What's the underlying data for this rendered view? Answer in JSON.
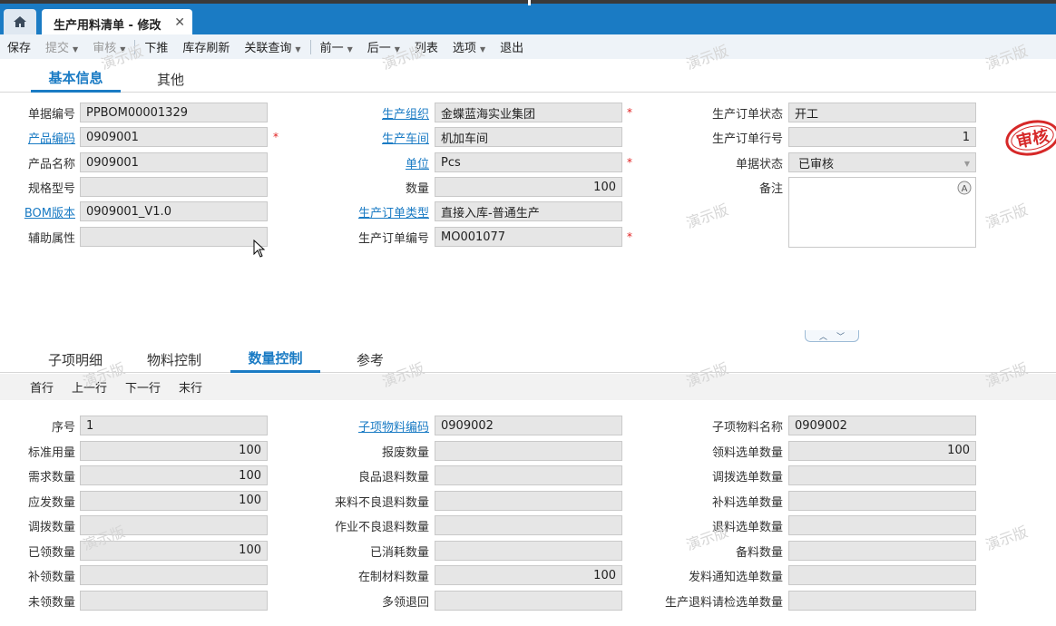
{
  "tabs": {
    "document_tab": "生产用料清单 - 修改"
  },
  "toolbar": [
    {
      "label": "保存",
      "disabled": false,
      "dropdown": false
    },
    {
      "label": "提交",
      "disabled": true,
      "dropdown": true
    },
    {
      "label": "审核",
      "disabled": true,
      "dropdown": true
    },
    {
      "sep": true
    },
    {
      "label": "下推",
      "disabled": false,
      "dropdown": false
    },
    {
      "label": "库存刷新",
      "disabled": false,
      "dropdown": false
    },
    {
      "label": "关联查询",
      "disabled": false,
      "dropdown": true
    },
    {
      "sep": true
    },
    {
      "label": "前一",
      "disabled": false,
      "dropdown": true
    },
    {
      "label": "后一",
      "disabled": false,
      "dropdown": true
    },
    {
      "label": "列表",
      "disabled": false,
      "dropdown": false
    },
    {
      "label": "选项",
      "disabled": false,
      "dropdown": true
    },
    {
      "label": "退出",
      "disabled": false,
      "dropdown": false
    }
  ],
  "watermark": "演示版",
  "header_tabs": [
    "基本信息",
    "其他"
  ],
  "header": {
    "bill_no": {
      "label": "单据编号",
      "value": "PPBOM00001329"
    },
    "material_code": {
      "label": "产品编码",
      "value": "0909001"
    },
    "material_name": {
      "label": "产品名称",
      "value": "0909001"
    },
    "spec": {
      "label": "规格型号",
      "value": ""
    },
    "bom_version": {
      "label": "BOM版本",
      "value": "0909001_V1.0"
    },
    "aux_prop": {
      "label": "辅助属性",
      "value": ""
    },
    "prd_org": {
      "label": "生产组织",
      "value": "金蝶蓝海实业集团"
    },
    "workshop": {
      "label": "生产车间",
      "value": "机加车间"
    },
    "unit": {
      "label": "单位",
      "value": "Pcs"
    },
    "qty": {
      "label": "数量",
      "value": "100"
    },
    "mo_type": {
      "label": "生产订单类型",
      "value": "直接入库-普通生产"
    },
    "mo_no": {
      "label": "生产订单编号",
      "value": "MO001077"
    },
    "mo_status": {
      "label": "生产订单状态",
      "value": "开工"
    },
    "mo_line": {
      "label": "生产订单行号",
      "value": "1"
    },
    "doc_status": {
      "label": "单据状态",
      "value": "已审核"
    },
    "remark": {
      "label": "备注",
      "value": ""
    }
  },
  "stamp": "审核",
  "entry_tabs": [
    "子项明细",
    "物料控制",
    "数量控制",
    "参考"
  ],
  "entry_nav": [
    "首行",
    "上一行",
    "下一行",
    "末行"
  ],
  "qty_control": {
    "col1": [
      {
        "label": "序号",
        "value": "1",
        "num": false
      },
      {
        "label": "标准用量",
        "value": "100",
        "num": true
      },
      {
        "label": "需求数量",
        "value": "100",
        "num": true
      },
      {
        "label": "应发数量",
        "value": "100",
        "num": true
      },
      {
        "label": "调拨数量",
        "value": "",
        "num": true
      },
      {
        "label": "已领数量",
        "value": "100",
        "num": true
      },
      {
        "label": "补领数量",
        "value": "",
        "num": true
      },
      {
        "label": "未领数量",
        "value": "",
        "num": true
      }
    ],
    "col2": [
      {
        "label": "子项物料编码",
        "value": "0909002",
        "num": false,
        "link": true
      },
      {
        "label": "报废数量",
        "value": "",
        "num": true
      },
      {
        "label": "良品退料数量",
        "value": "",
        "num": true
      },
      {
        "label": "来料不良退料数量",
        "value": "",
        "num": true
      },
      {
        "label": "作业不良退料数量",
        "value": "",
        "num": true
      },
      {
        "label": "已消耗数量",
        "value": "",
        "num": true
      },
      {
        "label": "在制材料数量",
        "value": "100",
        "num": true
      },
      {
        "label": "多领退回",
        "value": "",
        "num": true
      }
    ],
    "col3": [
      {
        "label": "子项物料名称",
        "value": "0909002",
        "num": false
      },
      {
        "label": "领料选单数量",
        "value": "100",
        "num": true
      },
      {
        "label": "调拨选单数量",
        "value": "",
        "num": true
      },
      {
        "label": "补料选单数量",
        "value": "",
        "num": true
      },
      {
        "label": "退料选单数量",
        "value": "",
        "num": true
      },
      {
        "label": "备料数量",
        "value": "",
        "num": true
      },
      {
        "label": "发料通知选单数量",
        "value": "",
        "num": true
      },
      {
        "label": "生产退料请检选单数量",
        "value": "",
        "num": true
      }
    ]
  },
  "colors": {
    "accent": "#1a7bc4",
    "required": "#e02020",
    "stamp": "#d62828"
  }
}
